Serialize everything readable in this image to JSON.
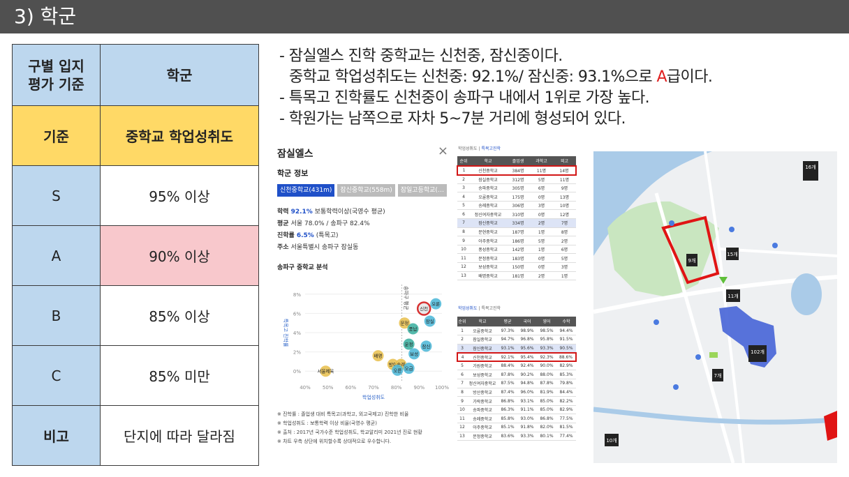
{
  "header": {
    "title": "3) 학군"
  },
  "criteria_table": {
    "header": {
      "label": "구별 입지\n평가 기준",
      "value": "학군"
    },
    "standard": {
      "label": "기준",
      "value": "중학교 학업성취도"
    },
    "grades": [
      {
        "grade": "S",
        "value": "95% 이상"
      },
      {
        "grade": "A",
        "value": "90% 이상"
      },
      {
        "grade": "B",
        "value": "85% 이상"
      },
      {
        "grade": "C",
        "value": "85% 미만"
      }
    ],
    "note": {
      "label": "비고",
      "value": "단지에 따라 달라짐"
    }
  },
  "bullets": {
    "line1": "- 잠실엘스 진학 중학교는 신천중, 잠신중이다.",
    "line2_pre": "중학교 학업성취도는 신천중: 92.1%/ 잠신중: 93.1%으로 ",
    "line2_grade": "A",
    "line2_post": "급이다.",
    "line3": "- 특목고 진학률도 신천중이 송파구 내에서 1위로 가장 높다.",
    "line4": "- 학원가는 남쪽으로 자차 5~7분 거리에 형성되어 있다."
  },
  "panel": {
    "title": "잠실엘스",
    "close": "×",
    "section": "학군 정보",
    "tabs": [
      "신천중학교(431m)",
      "잠신중학교(558m)",
      "잠일고등학교(…"
    ],
    "achieve_label": "학력",
    "achieve_value": "92.1%",
    "achieve_rest": "보통학력이상(국영수 평균)",
    "avg_label": "평균",
    "avg_value": "서울 78.0% / 송파구 82.4%",
    "adv_label": "진학률",
    "adv_value": "6.5%",
    "adv_rest": "(특목고)",
    "addr_label": "주소",
    "addr_value": "서울특별시 송파구 잠실동",
    "chart_title": "송파구 중학교 분석",
    "notes": [
      "※ 진학률 : 졸업생 대비 특목고(과학고, 외고국제고) 진학한 비율",
      "※ 학업성취도 : 보통학력 이상 비율(국영수 평균)",
      "※ 출처 : 2017년 국가수준 학업성취도, 학교알리미 2021년 진로 현황",
      "※ 차트 우측 상단에 위치할수록 상대적으로 우수합니다."
    ]
  },
  "chart_data": {
    "type": "scatter",
    "title": "송파구 중학교 분석",
    "xlabel": "학업성취도",
    "ylabel": "특목고 진학률",
    "x_ticks": [
      "40%",
      "50%",
      "60%",
      "70%",
      "80%",
      "90%",
      "100%"
    ],
    "y_ticks": [
      "0%",
      "2%",
      "4%",
      "6%",
      "8%"
    ],
    "xlim": [
      40,
      100
    ],
    "ylim": [
      -1,
      9
    ],
    "avg_label": "송파구 평균",
    "points": [
      {
        "label": "신천",
        "x": 92.1,
        "y": 6.5,
        "color": "#e8e8e8",
        "highlight": true
      },
      {
        "label": "오륜",
        "x": 97.3,
        "y": 7.0,
        "color": "#4fb8d8"
      },
      {
        "label": "잠실",
        "x": 94.7,
        "y": 5.2,
        "color": "#4fb8d8"
      },
      {
        "label": "문정",
        "x": 83.6,
        "y": 5.0,
        "color": "#e8c050"
      },
      {
        "label": "풍납",
        "x": 87.3,
        "y": 4.4,
        "color": "#3eb0a0"
      },
      {
        "label": "잠신",
        "x": 93.1,
        "y": 2.6,
        "color": "#4fb8d8"
      },
      {
        "label": "운정",
        "x": 85.5,
        "y": 2.8,
        "color": "#3eb0a0"
      },
      {
        "label": "보성",
        "x": 87.8,
        "y": 1.8,
        "color": "#4fb8d8"
      },
      {
        "label": "배명",
        "x": 72.0,
        "y": 1.6,
        "color": "#e8c050"
      },
      {
        "label": "방이",
        "x": 78.5,
        "y": 0.7,
        "color": "#e8c050"
      },
      {
        "label": "송례",
        "x": 82.0,
        "y": 0.7,
        "color": "#e8c050"
      },
      {
        "label": "오금",
        "x": 85.5,
        "y": 0.3,
        "color": "#4fb8d8"
      },
      {
        "label": "오륜",
        "x": 80.5,
        "y": 0.1,
        "color": "#4fb8d8"
      },
      {
        "label": "서울체육",
        "x": 49.0,
        "y": 0.0,
        "color": "#e8c050"
      }
    ]
  },
  "rank_table_1": {
    "tab_active": "학업성취도",
    "tab_other": "특목고진학",
    "columns": [
      "순위",
      "학교",
      "졸업생",
      "과학고",
      "외고"
    ],
    "rows": [
      [
        "1",
        "신천중학교",
        "384명",
        "11명",
        "14명"
      ],
      [
        "2",
        "잠실중학교",
        "312명",
        "5명",
        "11명"
      ],
      [
        "3",
        "송파중학교",
        "305명",
        "6명",
        "9명"
      ],
      [
        "4",
        "오륜중학교",
        "175명",
        "0명",
        "13명"
      ],
      [
        "5",
        "송례중학교",
        "306명",
        "3명",
        "10명"
      ],
      [
        "6",
        "정신여자중학교",
        "310명",
        "0명",
        "12명"
      ],
      [
        "7",
        "잠신중학교",
        "334명",
        "2명",
        "7명"
      ],
      [
        "8",
        "문현중학교",
        "187명",
        "1명",
        "8명"
      ],
      [
        "9",
        "아주중학교",
        "186명",
        "5명",
        "2명"
      ],
      [
        "10",
        "풍성중학교",
        "142명",
        "1명",
        "6명"
      ],
      [
        "11",
        "문정중학교",
        "183명",
        "0명",
        "5명"
      ],
      [
        "12",
        "보성중학교",
        "150명",
        "0명",
        "3명"
      ],
      [
        "13",
        "배명중학교",
        "181명",
        "2명",
        "1명"
      ]
    ]
  },
  "rank_table_2": {
    "tab_active": "학업성취도",
    "tab_other": "특목고진학",
    "columns": [
      "순위",
      "학교",
      "평균",
      "국어",
      "영어",
      "수학"
    ],
    "rows": [
      [
        "1",
        "오륜중학교",
        "97.3%",
        "98.9%",
        "98.5%",
        "94.4%"
      ],
      [
        "2",
        "잠실중학교",
        "94.7%",
        "96.8%",
        "95.8%",
        "91.5%"
      ],
      [
        "3",
        "잠신중학교",
        "93.1%",
        "95.6%",
        "93.3%",
        "90.5%"
      ],
      [
        "4",
        "신천중학교",
        "92.1%",
        "95.4%",
        "92.3%",
        "88.6%"
      ],
      [
        "5",
        "가원중학교",
        "88.4%",
        "92.4%",
        "90.0%",
        "82.9%"
      ],
      [
        "6",
        "보성중학교",
        "87.8%",
        "90.2%",
        "88.0%",
        "85.3%"
      ],
      [
        "7",
        "정신여자중학교",
        "87.5%",
        "94.8%",
        "87.8%",
        "79.8%"
      ],
      [
        "8",
        "방산중학교",
        "87.4%",
        "96.0%",
        "81.9%",
        "84.4%"
      ],
      [
        "9",
        "가락중학교",
        "86.8%",
        "93.1%",
        "85.0%",
        "82.2%"
      ],
      [
        "10",
        "송파중학교",
        "86.3%",
        "91.1%",
        "85.0%",
        "82.9%"
      ],
      [
        "11",
        "송례중학교",
        "85.8%",
        "93.0%",
        "86.8%",
        "77.5%"
      ],
      [
        "12",
        "아주중학교",
        "85.1%",
        "91.8%",
        "82.0%",
        "81.5%"
      ],
      [
        "13",
        "문정중학교",
        "83.6%",
        "93.3%",
        "80.1%",
        "77.4%"
      ]
    ]
  },
  "map": {
    "labels": {
      "m16": "16개",
      "m15": "15개",
      "m9": "9개",
      "m11": "11개",
      "m102": "102개",
      "m7": "7개",
      "m10": "10개"
    }
  }
}
